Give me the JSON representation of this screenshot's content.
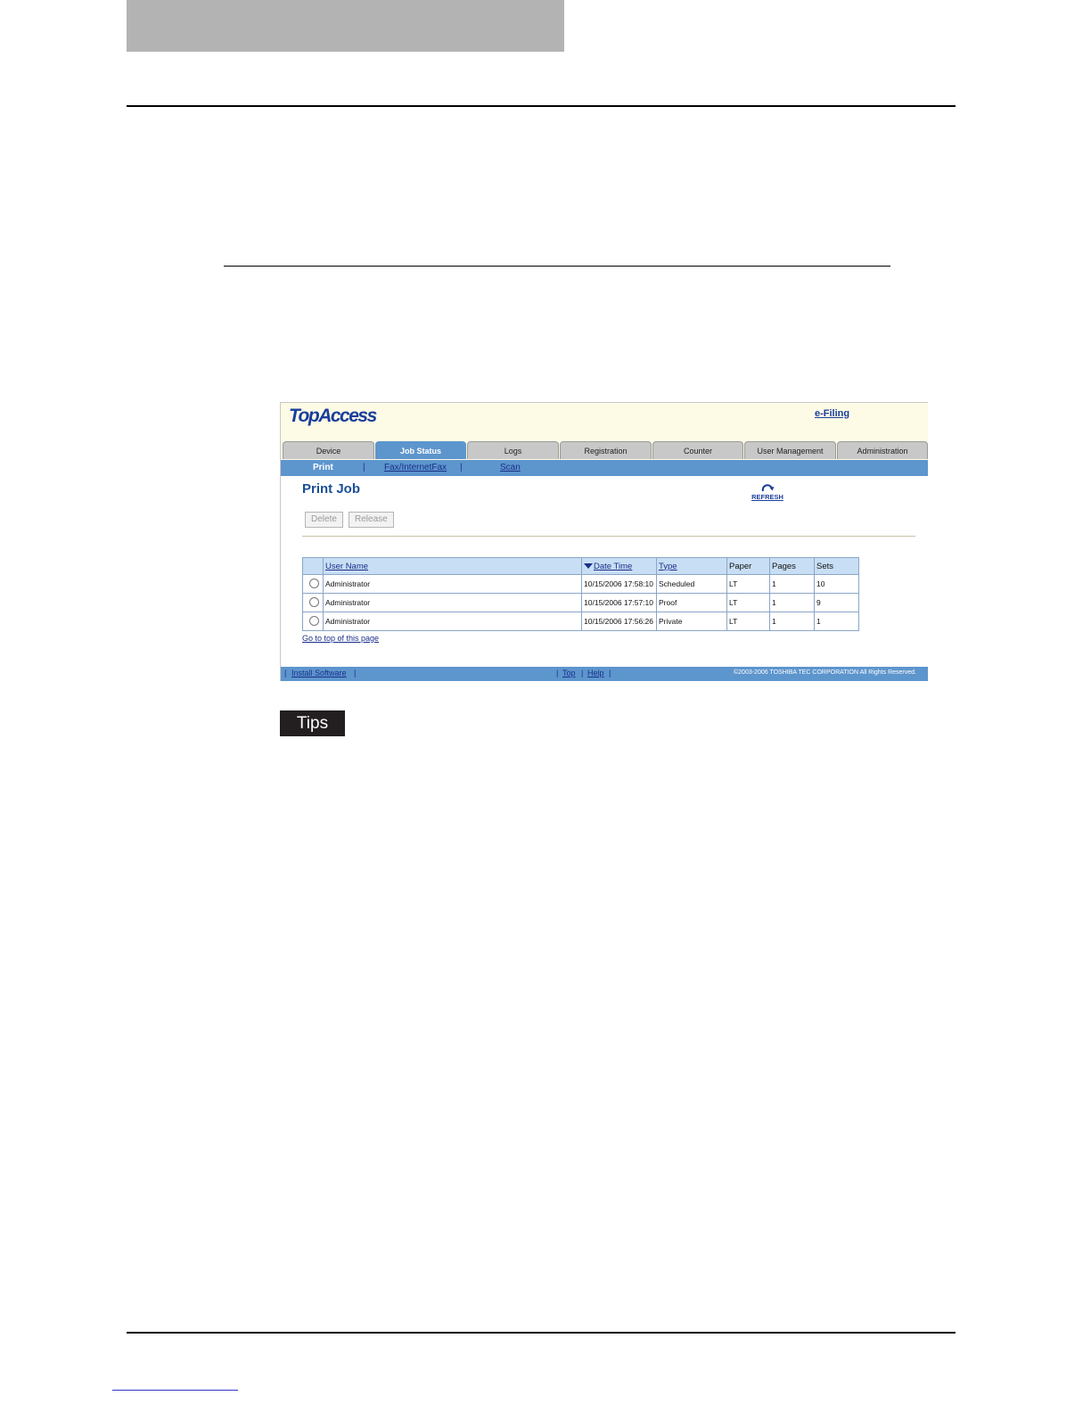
{
  "app": {
    "logo": "TopAccess",
    "efiling_link": "e-Filing"
  },
  "tabs": [
    "Device",
    "Job Status",
    "Logs",
    "Registration",
    "Counter",
    "User Management",
    "Administration"
  ],
  "subnav": {
    "print": "Print",
    "sep": "|",
    "fax": "Fax/InternetFax",
    "scan": "Scan"
  },
  "page": {
    "title": "Print Job",
    "refresh_label": "REFRESH",
    "delete_button": "Delete",
    "release_button": "Release",
    "go_top": "Go to top of this page"
  },
  "table": {
    "headers": {
      "user_name": "User Name",
      "date_time": "Date Time",
      "type": "Type",
      "paper": "Paper",
      "pages": "Pages",
      "sets": "Sets"
    },
    "rows": [
      {
        "user": "Administrator",
        "date": "10/15/2006 17:58:10",
        "type": "Scheduled",
        "paper": "LT",
        "pages": "1",
        "sets": "10"
      },
      {
        "user": "Administrator",
        "date": "10/15/2006 17:57:10",
        "type": "Proof",
        "paper": "LT",
        "pages": "1",
        "sets": "9"
      },
      {
        "user": "Administrator",
        "date": "10/15/2006 17:56:26",
        "type": "Private",
        "paper": "LT",
        "pages": "1",
        "sets": "1"
      }
    ]
  },
  "footer": {
    "pipe": "|",
    "install_software": "Install Software",
    "top": "Top",
    "help": "Help",
    "copyright": "©2003-2006 TOSHIBA TEC CORPORATION All Rights Reserved."
  },
  "tips_label": "Tips"
}
